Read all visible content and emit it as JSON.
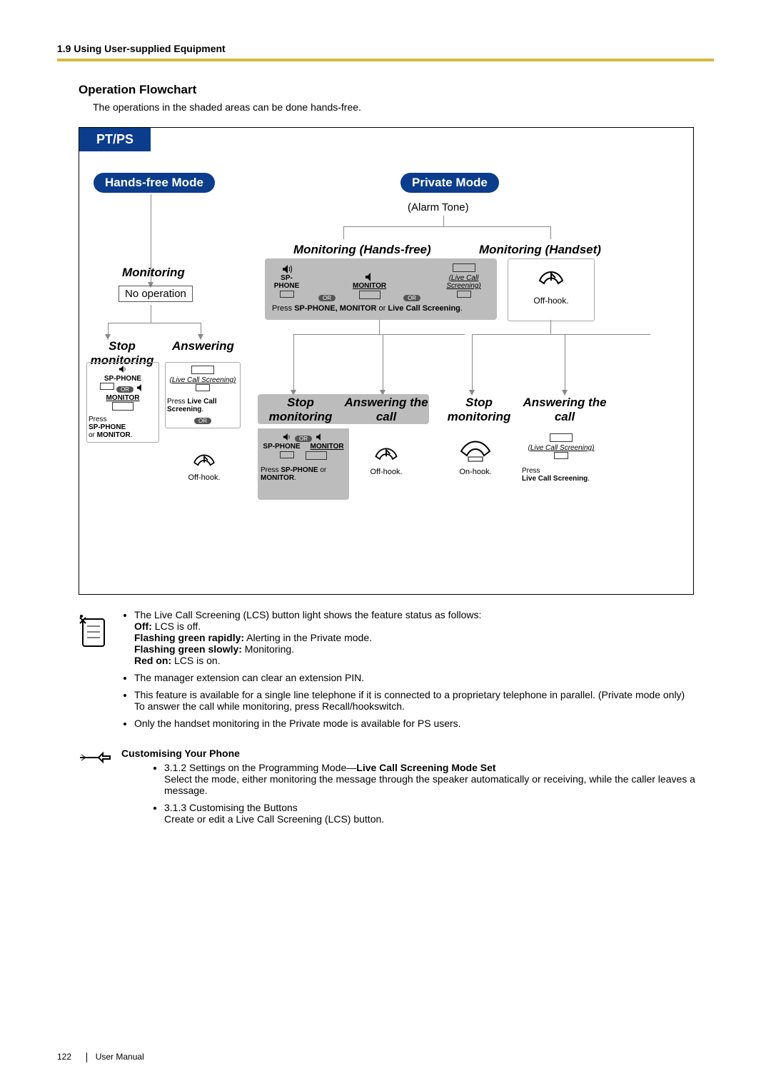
{
  "header": "1.9 Using User-supplied Equipment",
  "section_title": "Operation Flowchart",
  "intro": "The operations in the shaded areas can be done hands-free.",
  "flow": {
    "tab": "PT/PS",
    "hands_free_mode": "Hands-free Mode",
    "private_mode": "Private Mode",
    "alarm_tone": "(Alarm Tone)",
    "monitoring": "Monitoring",
    "monitoring_hands_free": "Monitoring (Hands-free)",
    "monitoring_handset": "Monitoring (Handset)",
    "no_operation": "No operation",
    "press_sp_monitor_lcs_a": "Press ",
    "press_sp_monitor_lcs_b": "SP-PHONE, MONITOR",
    "press_sp_monitor_lcs_c": " or ",
    "press_sp_monitor_lcs_d": "Live Call Screening",
    "press_sp_monitor_lcs_e": ".",
    "off_hook": "Off-hook.",
    "on_hook": "On-hook.",
    "stop_monitoring": "Stop monitoring",
    "answering": "Answering",
    "answering_the_call": "Answering the call",
    "press_lcs_a": "Press ",
    "press_lcs_b": "Live Call Screening",
    "press_lcs_c": ".",
    "press_sp_or_monitor_a": "Press ",
    "press_sp_or_monitor_b": "SP-PHONE",
    "press_sp_or_monitor_c": " or ",
    "press_sp_or_monitor_d": "MONITOR",
    "press_sp_or_monitor_e": ".",
    "sp_phone_label": "SP-PHONE",
    "monitor_label": "MONITOR",
    "lcs_tiny": "(Live Call Screening)",
    "or_label": "OR"
  },
  "notes": {
    "lcs_intro": "The Live Call Screening (LCS) button light shows the feature status as follows:",
    "off_b": "Off:",
    "off_t": " LCS is off.",
    "fgr_b": "Flashing green rapidly:",
    "fgr_t": " Alerting in the Private mode.",
    "fgs_b": "Flashing green slowly:",
    "fgs_t": " Monitoring.",
    "red_b": "Red on:",
    "red_t": " LCS is on.",
    "bullet2": "The manager extension can clear an extension PIN.",
    "bullet3a": "This feature is available for a single line telephone if it is connected to a proprietary telephone in parallel. (Private mode only)",
    "bullet3b": "To answer the call while monitoring, press Recall/hookswitch.",
    "bullet4": "Only the handset monitoring in the Private mode is available for PS users."
  },
  "customise": {
    "title": "Customising Your Phone",
    "b1a": "3.1.2 Settings on the Programming Mode—",
    "b1b": "Live Call Screening Mode Set",
    "b1c": "Select the mode, either monitoring the message through the speaker automatically or receiving, while the caller leaves a message.",
    "b2a": "3.1.3 Customising the Buttons",
    "b2b": "Create or edit a Live Call Screening (LCS) button."
  },
  "footer": {
    "page": "122",
    "manual": "User Manual"
  }
}
